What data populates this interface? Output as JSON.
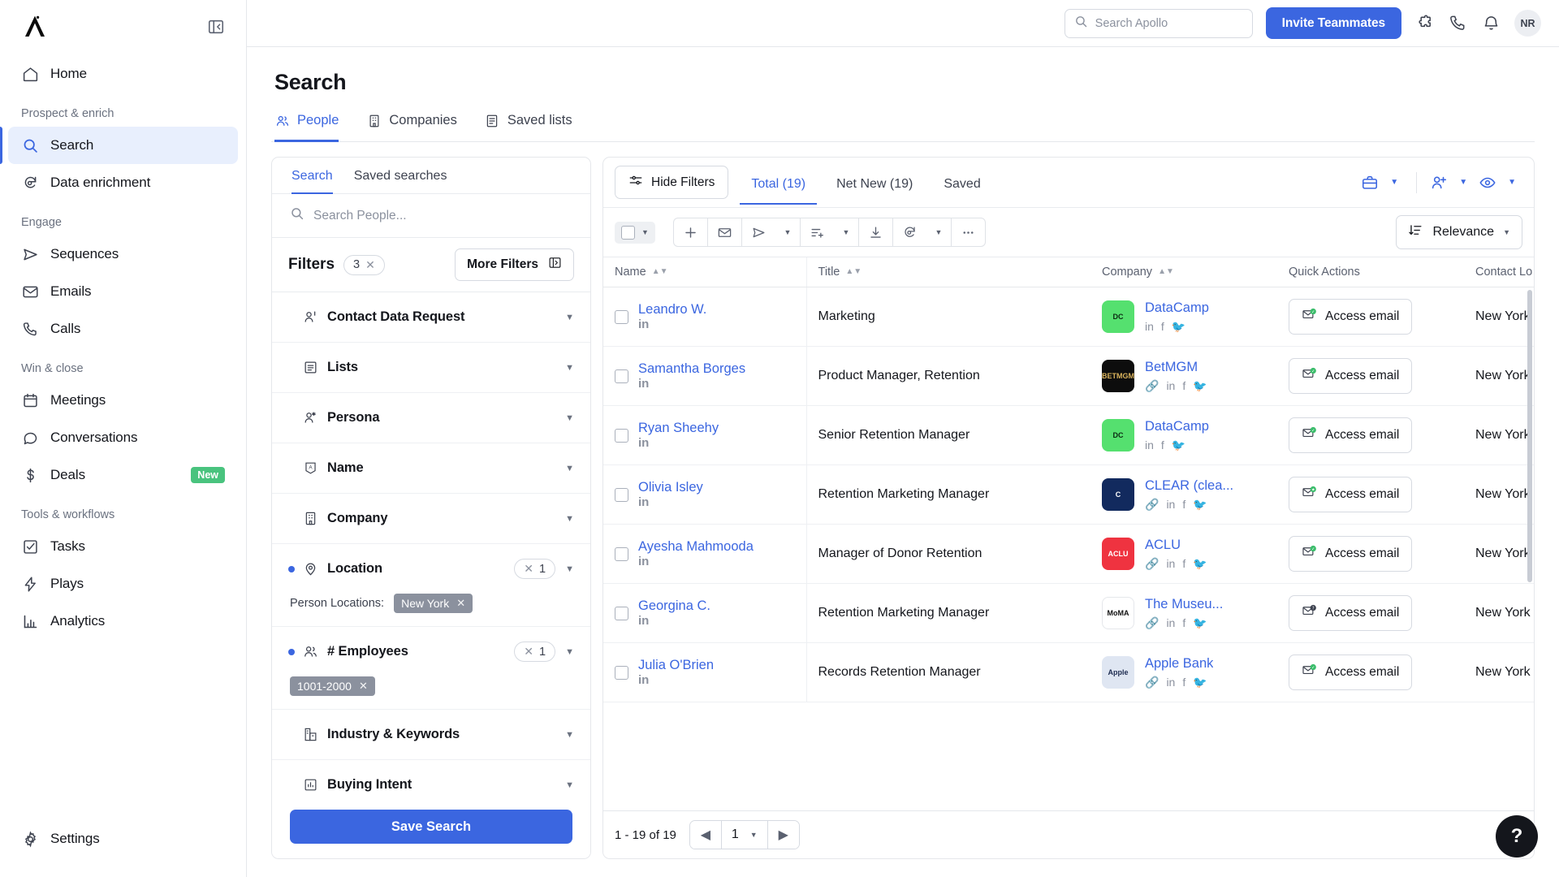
{
  "sidebar": {
    "logo_name": "apollo-logo",
    "items": [
      {
        "label": "Home",
        "icon": "home-icon",
        "key": "home"
      }
    ],
    "groups": [
      {
        "label": "Prospect & enrich",
        "items": [
          {
            "label": "Search",
            "icon": "search-icon",
            "key": "search",
            "active": true
          },
          {
            "label": "Data enrichment",
            "icon": "refresh-data-icon",
            "key": "data-enrichment"
          }
        ]
      },
      {
        "label": "Engage",
        "items": [
          {
            "label": "Sequences",
            "icon": "send-icon",
            "key": "sequences"
          },
          {
            "label": "Emails",
            "icon": "envelope-icon",
            "key": "emails"
          },
          {
            "label": "Calls",
            "icon": "phone-icon",
            "key": "calls"
          }
        ]
      },
      {
        "label": "Win & close",
        "items": [
          {
            "label": "Meetings",
            "icon": "calendar-icon",
            "key": "meetings"
          },
          {
            "label": "Conversations",
            "icon": "chat-bubble-icon",
            "key": "conversations"
          },
          {
            "label": "Deals",
            "icon": "dollar-icon",
            "key": "deals",
            "badge": "New"
          }
        ]
      },
      {
        "label": "Tools & workflows",
        "items": [
          {
            "label": "Tasks",
            "icon": "check-square-icon",
            "key": "tasks"
          },
          {
            "label": "Plays",
            "icon": "lightning-icon",
            "key": "plays"
          },
          {
            "label": "Analytics",
            "icon": "bar-chart-icon",
            "key": "analytics"
          }
        ]
      }
    ],
    "settings": {
      "label": "Settings",
      "icon": "gear-icon"
    }
  },
  "topbar": {
    "search_placeholder": "Search Apollo",
    "invite_label": "Invite Teammates",
    "icons": [
      "puzzle-piece-icon",
      "phone-icon",
      "bell-icon"
    ],
    "avatar_initials": "NR"
  },
  "page": {
    "title": "Search",
    "tabs": [
      {
        "label": "People",
        "icon": "people-icon",
        "active": true
      },
      {
        "label": "Companies",
        "icon": "building-icon",
        "active": false
      },
      {
        "label": "Saved lists",
        "icon": "list-icon",
        "active": false
      }
    ]
  },
  "filters_panel": {
    "tabs": [
      {
        "label": "Search",
        "active": true
      },
      {
        "label": "Saved searches",
        "active": false
      }
    ],
    "search_placeholder": "Search People...",
    "filters_title": "Filters",
    "filters_count": "3",
    "more_filters_label": "More Filters",
    "save_search_label": "Save Search",
    "rows": [
      {
        "label": "Contact Data Request",
        "icon": "person-request-icon",
        "active": false
      },
      {
        "label": "Lists",
        "icon": "list-icon",
        "active": false
      },
      {
        "label": "Persona",
        "icon": "person-star-icon",
        "active": false
      },
      {
        "label": "Name",
        "icon": "name-tag-icon",
        "active": false
      },
      {
        "label": "Company",
        "icon": "building-icon",
        "active": false
      },
      {
        "label": "Location",
        "icon": "map-pin-icon",
        "active": true,
        "count": "1",
        "sub_label": "Person Locations:",
        "chips": [
          "New York"
        ]
      },
      {
        "label": "# Employees",
        "icon": "people-icon",
        "active": true,
        "count": "1",
        "sub_label": "",
        "chips": [
          "1001-2000"
        ]
      },
      {
        "label": "Industry & Keywords",
        "icon": "industry-icon",
        "active": false
      },
      {
        "label": "Buying Intent",
        "icon": "bar-chart-icon",
        "active": false
      }
    ]
  },
  "results": {
    "hide_filters_label": "Hide Filters",
    "tabs": [
      {
        "label": "Total (19)",
        "active": true
      },
      {
        "label": "Net New (19)",
        "active": false
      },
      {
        "label": "Saved",
        "active": false
      }
    ],
    "header_icons": [
      "briefcase-icon",
      "add-person-icon",
      "eye-icon"
    ],
    "action_icons": [
      "plus-icon",
      "envelope-icon",
      "send-icon",
      "list-add-icon",
      "download-icon",
      "refresh-icon",
      "more-horizontal-icon"
    ],
    "sort_label": "Relevance",
    "columns": [
      {
        "label": "Name",
        "sortable": true
      },
      {
        "label": "Title",
        "sortable": true
      },
      {
        "label": "Company",
        "sortable": true
      },
      {
        "label": "Quick Actions",
        "sortable": false
      },
      {
        "label": "Contact Lo",
        "sortable": false
      }
    ],
    "access_email_label": "Access email",
    "rows": [
      {
        "name": "Leandro W.",
        "title": "Marketing",
        "company": "DataCamp",
        "logo_text": "DC",
        "logo_bg": "#55e06f",
        "logo_color": "#0b2a12",
        "socials": [
          "in",
          "f",
          "t"
        ],
        "email_state": "verified",
        "location": "New York"
      },
      {
        "name": "Samantha Borges",
        "title": "Product Manager, Retention",
        "company": "BetMGM",
        "logo_text": "BETMGM",
        "logo_bg": "#0d0d0d",
        "logo_color": "#d9b25c",
        "socials": [
          "link",
          "in",
          "f",
          "t"
        ],
        "email_state": "verified",
        "location": "New York"
      },
      {
        "name": "Ryan Sheehy",
        "title": "Senior Retention Manager",
        "company": "DataCamp",
        "logo_text": "DC",
        "logo_bg": "#55e06f",
        "logo_color": "#0b2a12",
        "socials": [
          "in",
          "f",
          "t"
        ],
        "email_state": "verified",
        "location": "New York"
      },
      {
        "name": "Olivia Isley",
        "title": "Retention Marketing Manager",
        "company": "CLEAR (clea...",
        "logo_text": "C",
        "logo_bg": "#122a5e",
        "logo_color": "#ffffff",
        "socials": [
          "link",
          "in",
          "f",
          "t"
        ],
        "email_state": "star",
        "location": "New York"
      },
      {
        "name": "Ayesha Mahmooda",
        "title": "Manager of Donor Retention",
        "company": "ACLU",
        "logo_text": "ACLU",
        "logo_bg": "#ef3340",
        "logo_color": "#ffffff",
        "socials": [
          "link",
          "in",
          "f",
          "t"
        ],
        "email_state": "verified",
        "location": "New York"
      },
      {
        "name": "Georgina C.",
        "title": "Retention Marketing Manager",
        "company": "The Museu...",
        "logo_text": "MoMA",
        "logo_bg": "#ffffff",
        "logo_color": "#111111",
        "socials": [
          "link",
          "in",
          "f",
          "t"
        ],
        "email_state": "question",
        "location": "New York"
      },
      {
        "name": "Julia O'Brien",
        "title": "Records Retention Manager",
        "company": "Apple Bank",
        "logo_text": "Apple",
        "logo_bg": "#dfe6f2",
        "logo_color": "#1d2b50",
        "socials": [
          "link",
          "in",
          "f",
          "t"
        ],
        "email_state": "verified",
        "location": "New York"
      }
    ],
    "pagination": {
      "range_text": "1 - 19 of 19",
      "page": "1"
    }
  },
  "help": {
    "label": "?"
  },
  "colors": {
    "accent": "#3b66e0",
    "new_badge": "#49c37e",
    "chip": "#8b919e"
  }
}
